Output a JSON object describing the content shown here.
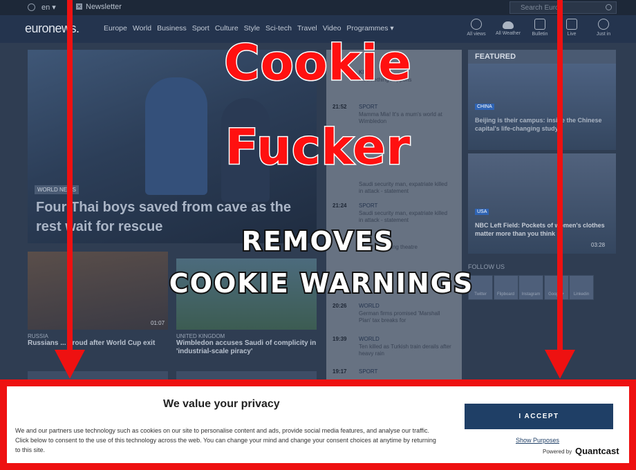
{
  "colors": {
    "accent_red": "#ee1111",
    "banner_button": "#1f3f66",
    "nav_bg": "#24344e"
  },
  "topbar": {
    "language": "en ▾",
    "newsletter": "Newsletter",
    "search_placeholder": "Search Euron"
  },
  "nav": {
    "logo": "euronews.",
    "links": [
      "Europe",
      "World",
      "Business",
      "Sport",
      "Culture",
      "Style",
      "Sci-tech",
      "Travel",
      "Video",
      "Programmes ▾"
    ],
    "icons": [
      {
        "label": "All views",
        "icon": "eye-icon"
      },
      {
        "label": "All Weather",
        "icon": "cloud-icon"
      },
      {
        "label": "Bulletin",
        "icon": "bulletin-icon"
      },
      {
        "label": "Live",
        "icon": "play-icon"
      },
      {
        "label": "Just in",
        "icon": "clock-icon"
      }
    ]
  },
  "hero": {
    "tag": "WORLD NEWS",
    "headline": "Four Thai boys saved from cave as the rest wait for rescue"
  },
  "latest": [
    {
      "time": "",
      "category": "KING",
      "text": "...something happens"
    },
    {
      "time": "21:52",
      "category": "SPORT",
      "text": "Mamma Mia! It's a mum's world at Wimbledon"
    },
    {
      "time": "",
      "category": "",
      "text": "Saudi security man, expatriate killed in attack - statement"
    },
    {
      "time": "21:24",
      "category": "SPORT",
      "text": "Saudi security man, expatriate killed in attack - statement"
    },
    {
      "time": "",
      "category": "",
      "text": "...final cast ...ing theatre"
    },
    {
      "time": "20:26",
      "category": "WORLD",
      "text": "German firms promised 'Marshall Plan' tax breaks for"
    },
    {
      "time": "19:39",
      "category": "WORLD",
      "text": "Ten killed as Turkish train derails after heavy rain"
    },
    {
      "time": "19:17",
      "category": "SPORT",
      "text": "..."
    }
  ],
  "featured": {
    "heading": "FEATURED",
    "item1": {
      "badge": "CHINA",
      "caption": "Beijing is their campus: inside the Chinese capital's life-changing study..."
    },
    "item2": {
      "badge": "USA",
      "caption": "NBC Left Field: Pockets of women's clothes matter more than you think",
      "time": "03:28"
    }
  },
  "follow": {
    "label": "FOLLOW US",
    "socials": [
      "Twitter",
      "Flipboard",
      "Instagram",
      "Google+",
      "Linkedin"
    ]
  },
  "thumbs": [
    {
      "category": "RUSSIA",
      "title": "Russians ... proud after World Cup exit",
      "time": "01:07"
    },
    {
      "category": "UNITED KINGDOM",
      "title": "Wimbledon accuses Saudi of complicity in 'industrial-scale piracy'"
    }
  ],
  "overlay": {
    "title_line1": "Cookie",
    "title_line2": "Fucker",
    "subtitle_line1": "REMOVES",
    "subtitle_line2": "COOKIE WARNINGS"
  },
  "consent": {
    "title": "We value your privacy",
    "body": "We and our partners use technology such as cookies on our site to personalise content and ads, provide social media features, and analyse our traffic. Click below to consent to the use of this technology across the web. You can change your mind and change your consent choices at anytime by returning to this site.",
    "accept_label": "I ACCEPT",
    "purposes_label": "Show Purposes",
    "powered_by": "Powered by",
    "brand": "Quantcast"
  }
}
